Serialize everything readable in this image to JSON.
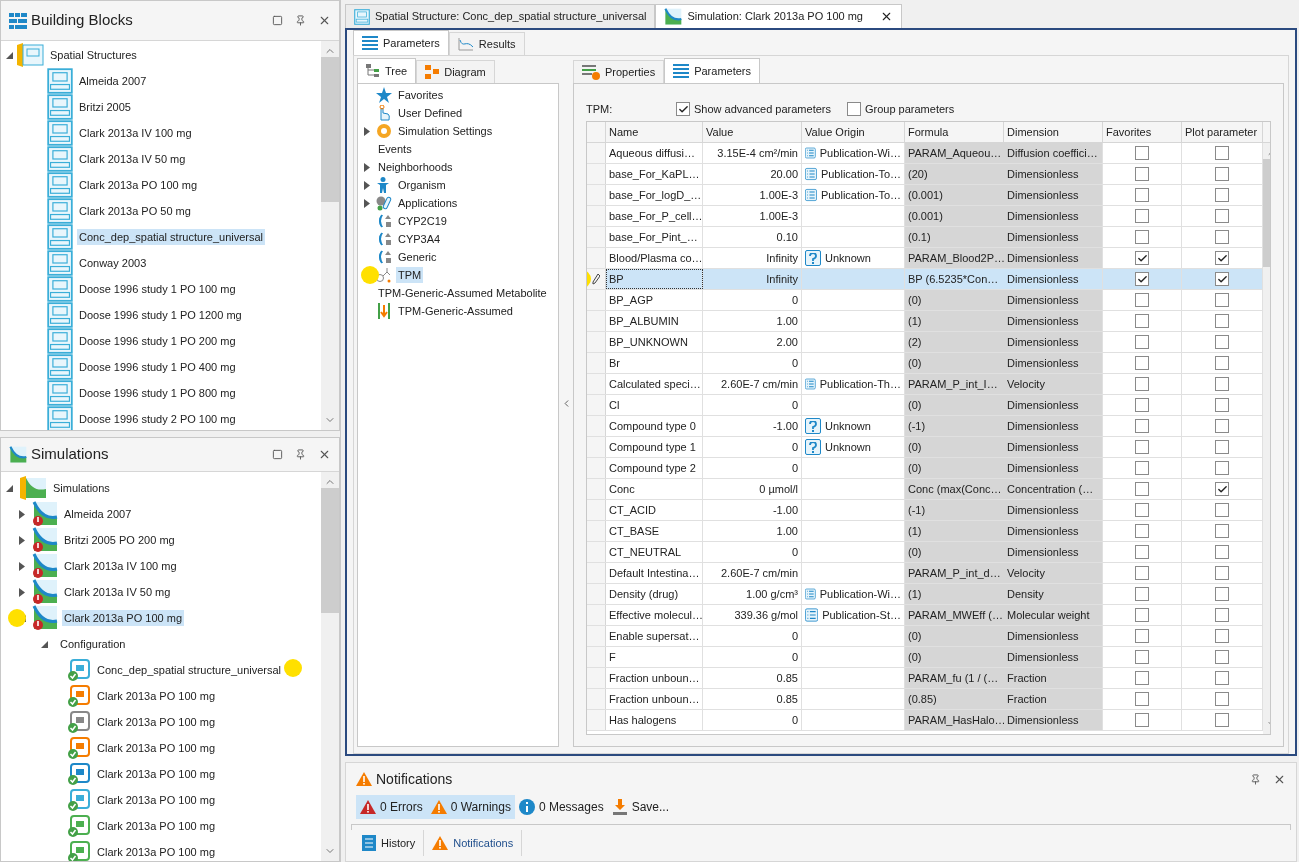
{
  "building_blocks": {
    "title": "Building Blocks",
    "tree": [
      {
        "label": "Spatial Structures",
        "expanded": true,
        "selected": false,
        "children": [
          {
            "label": "Almeida 2007",
            "selected": false
          },
          {
            "label": "Britzi 2005",
            "selected": false
          },
          {
            "label": "Clark 2013a IV 100 mg",
            "selected": false
          },
          {
            "label": "Clark 2013a IV 50 mg",
            "selected": false
          },
          {
            "label": "Clark 2013a PO 100 mg",
            "selected": false
          },
          {
            "label": "Clark 2013a PO 50 mg",
            "selected": false
          },
          {
            "label": "Conc_dep_spatial structure_universal",
            "selected": true
          },
          {
            "label": "Conway 2003",
            "selected": false
          },
          {
            "label": "Doose 1996 study 1 PO 100 mg",
            "selected": false
          },
          {
            "label": "Doose 1996 study 1 PO 1200 mg",
            "selected": false
          },
          {
            "label": "Doose 1996 study 1 PO 200 mg",
            "selected": false
          },
          {
            "label": "Doose 1996 study 1 PO 400 mg",
            "selected": false
          },
          {
            "label": "Doose 1996 study 1 PO 800 mg",
            "selected": false
          },
          {
            "label": "Doose 1996 study 2 PO 100 mg",
            "selected": false
          }
        ]
      }
    ]
  },
  "simulations": {
    "title": "Simulations",
    "tree": [
      {
        "label": "Simulations",
        "expanded": true,
        "selected": false,
        "kind": "folder",
        "children": [
          {
            "label": "Almeida 2007",
            "expanded": false,
            "selected": false,
            "kind": "simulation"
          },
          {
            "label": "Britzi 2005 PO 200 mg",
            "expanded": false,
            "selected": false,
            "kind": "simulation"
          },
          {
            "label": "Clark 2013a IV 100 mg",
            "expanded": false,
            "selected": false,
            "kind": "simulation"
          },
          {
            "label": "Clark 2013a IV 50 mg",
            "expanded": false,
            "selected": false,
            "kind": "simulation"
          },
          {
            "label": "Clark 2013a PO 100 mg",
            "expanded": true,
            "selected": true,
            "marked": true,
            "kind": "simulation",
            "children": [
              {
                "label": "Configuration",
                "expanded": true,
                "selected": false,
                "children": [
                  {
                    "label": "Conc_dep_spatial structure_universal",
                    "selected": false,
                    "marked": true,
                    "kind": "block"
                  },
                  {
                    "label": "Clark 2013a PO 100 mg",
                    "selected": false,
                    "kind": "block"
                  },
                  {
                    "label": "Clark 2013a PO 100 mg",
                    "selected": false,
                    "kind": "block"
                  },
                  {
                    "label": "Clark 2013a PO 100 mg",
                    "selected": false,
                    "kind": "block"
                  },
                  {
                    "label": "Clark 2013a PO 100 mg",
                    "selected": false,
                    "kind": "block"
                  },
                  {
                    "label": "Clark 2013a PO 100 mg",
                    "selected": false,
                    "kind": "block"
                  },
                  {
                    "label": "Clark 2013a PO 100 mg",
                    "selected": false,
                    "kind": "block"
                  },
                  {
                    "label": "Clark 2013a PO 100 mg",
                    "selected": false,
                    "kind": "block"
                  }
                ]
              }
            ]
          }
        ]
      }
    ]
  },
  "document_tabs": [
    {
      "label": "Spatial Structure: Conc_dep_spatial structure_universal",
      "selected": false,
      "kind": "spatial"
    },
    {
      "label": "Simulation: Clark 2013a PO 100 mg",
      "selected": true,
      "kind": "simulation"
    }
  ],
  "view_tabs": [
    {
      "label": "Parameters",
      "selected": true,
      "kind": "list"
    },
    {
      "label": "Results",
      "selected": false,
      "kind": "chart"
    }
  ],
  "nav_tabs": [
    {
      "label": "Tree",
      "selected": true,
      "kind": "tree"
    },
    {
      "label": "Diagram",
      "selected": false,
      "kind": "diagram"
    }
  ],
  "nav_tree": [
    {
      "label": "Favorites",
      "selected": false,
      "kind": "star"
    },
    {
      "label": "User Defined",
      "selected": false,
      "kind": "hand"
    },
    {
      "label": "Simulation Settings",
      "selected": false,
      "expanded": false,
      "kind": "gear"
    },
    {
      "label": "Events",
      "selected": false,
      "kind": "none"
    },
    {
      "label": "Neighborhoods",
      "selected": false,
      "expanded": false,
      "kind": "none"
    },
    {
      "label": "Organism",
      "selected": false,
      "expanded": false,
      "kind": "person"
    },
    {
      "label": "Applications",
      "selected": false,
      "expanded": false,
      "kind": "pill"
    },
    {
      "label": "CYP2C19",
      "selected": false,
      "kind": "enzyme"
    },
    {
      "label": "CYP3A4",
      "selected": false,
      "kind": "enzyme"
    },
    {
      "label": "Generic",
      "selected": false,
      "kind": "enzyme"
    },
    {
      "label": "TPM",
      "selected": true,
      "marked": true,
      "kind": "molecule"
    },
    {
      "label": "TPM-Generic-Assumed Metabolite",
      "selected": false,
      "kind": "none"
    },
    {
      "label": "TPM-Generic-Assumed",
      "selected": false,
      "kind": "transport"
    }
  ],
  "detail_tabs": [
    {
      "label": "Properties",
      "selected": false,
      "kind": "properties"
    },
    {
      "label": "Parameters",
      "selected": true,
      "kind": "list"
    }
  ],
  "parameters": {
    "label": "TPM:",
    "options": [
      {
        "label": "Show advanced parameters",
        "checked": true
      },
      {
        "label": "Group parameters",
        "checked": false
      }
    ],
    "columns": [
      "Name",
      "Value",
      "Value Origin",
      "Formula",
      "Dimension",
      "Favorites",
      "Plot parameter"
    ],
    "rows": [
      {
        "name": "Aqueous diffusi…",
        "value": "3.15E-4 cm²/min",
        "origin": {
          "label": "Publication-Wi…",
          "kind": "publication"
        },
        "formula": "PARAM_Aqueou…",
        "dimension": "Diffusion coeffici…",
        "favorite": false,
        "plot": false,
        "selected": false
      },
      {
        "name": "base_For_KaPL…",
        "value": "20.00",
        "origin": {
          "label": "Publication-To…",
          "kind": "publication"
        },
        "formula": "(20)",
        "dimension": "Dimensionless",
        "favorite": false,
        "plot": false,
        "selected": false
      },
      {
        "name": "base_For_logD_…",
        "value": "1.00E-3",
        "origin": {
          "label": "Publication-To…",
          "kind": "publication"
        },
        "formula": "(0.001)",
        "dimension": "Dimensionless",
        "favorite": false,
        "plot": false,
        "selected": false
      },
      {
        "name": "base_For_P_cell…",
        "value": "1.00E-3",
        "formula": "(0.001)",
        "dimension": "Dimensionless",
        "favorite": false,
        "plot": false,
        "selected": false
      },
      {
        "name": "base_For_Pint_…",
        "value": "0.10",
        "formula": "(0.1)",
        "dimension": "Dimensionless",
        "favorite": false,
        "plot": false,
        "selected": false
      },
      {
        "name": "Blood/Plasma co…",
        "value": "Infinity",
        "origin": {
          "label": "Unknown",
          "kind": "unknown"
        },
        "formula": "PARAM_Blood2P…",
        "dimension": "Dimensionless",
        "favorite": true,
        "plot": true,
        "selected": false
      },
      {
        "name": "BP",
        "value": "Infinity",
        "formula": "BP (6.5235*Con…",
        "dimension": "Dimensionless",
        "favorite": true,
        "plot": true,
        "selected": true,
        "editing": true
      },
      {
        "name": "BP_AGP",
        "value": "0",
        "formula": "(0)",
        "dimension": "Dimensionless",
        "favorite": false,
        "plot": false,
        "selected": false
      },
      {
        "name": "BP_ALBUMIN",
        "value": "1.00",
        "formula": "(1)",
        "dimension": "Dimensionless",
        "favorite": false,
        "plot": false,
        "selected": false
      },
      {
        "name": "BP_UNKNOWN",
        "value": "2.00",
        "formula": "(2)",
        "dimension": "Dimensionless",
        "favorite": false,
        "plot": false,
        "selected": false
      },
      {
        "name": "Br",
        "value": "0",
        "formula": "(0)",
        "dimension": "Dimensionless",
        "favorite": false,
        "plot": false,
        "selected": false
      },
      {
        "name": "Calculated speci…",
        "value": "2.60E-7 cm/min",
        "origin": {
          "label": "Publication-Th…",
          "kind": "publication"
        },
        "formula": "PARAM_P_int_I…",
        "dimension": "Velocity",
        "favorite": false,
        "plot": false,
        "selected": false
      },
      {
        "name": "Cl",
        "value": "0",
        "formula": "(0)",
        "dimension": "Dimensionless",
        "favorite": false,
        "plot": false,
        "selected": false
      },
      {
        "name": "Compound type 0",
        "value": "-1.00",
        "origin": {
          "label": "Unknown",
          "kind": "unknown"
        },
        "formula": "(-1)",
        "dimension": "Dimensionless",
        "favorite": false,
        "plot": false,
        "selected": false
      },
      {
        "name": "Compound type 1",
        "value": "0",
        "origin": {
          "label": "Unknown",
          "kind": "unknown"
        },
        "formula": "(0)",
        "dimension": "Dimensionless",
        "favorite": false,
        "plot": false,
        "selected": false
      },
      {
        "name": "Compound type 2",
        "value": "0",
        "formula": "(0)",
        "dimension": "Dimensionless",
        "favorite": false,
        "plot": false,
        "selected": false
      },
      {
        "name": "Conc",
        "value": "0 µmol/l",
        "formula": "Conc (max(Conc…",
        "dimension": "Concentration (…",
        "favorite": false,
        "plot": true,
        "selected": false
      },
      {
        "name": "CT_ACID",
        "value": "-1.00",
        "formula": "(-1)",
        "dimension": "Dimensionless",
        "favorite": false,
        "plot": false,
        "selected": false
      },
      {
        "name": "CT_BASE",
        "value": "1.00",
        "formula": "(1)",
        "dimension": "Dimensionless",
        "favorite": false,
        "plot": false,
        "selected": false
      },
      {
        "name": "CT_NEUTRAL",
        "value": "0",
        "formula": "(0)",
        "dimension": "Dimensionless",
        "favorite": false,
        "plot": false,
        "selected": false
      },
      {
        "name": "Default Intestina…",
        "value": "2.60E-7 cm/min",
        "formula": "PARAM_P_int_d…",
        "dimension": "Velocity",
        "favorite": false,
        "plot": false,
        "selected": false
      },
      {
        "name": "Density (drug)",
        "value": "1.00 g/cm³",
        "origin": {
          "label": "Publication-Wi…",
          "kind": "publication"
        },
        "formula": "(1)",
        "dimension": "Density",
        "favorite": false,
        "plot": false,
        "selected": false
      },
      {
        "name": "Effective molecul…",
        "value": "339.36 g/mol",
        "origin": {
          "label": "Publication-St…",
          "kind": "publication"
        },
        "formula": "PARAM_MWEff (…",
        "dimension": "Molecular weight",
        "favorite": false,
        "plot": false,
        "selected": false
      },
      {
        "name": "Enable supersat…",
        "value": "0",
        "formula": "(0)",
        "dimension": "Dimensionless",
        "favorite": false,
        "plot": false,
        "selected": false
      },
      {
        "name": "F",
        "value": "0",
        "formula": "(0)",
        "dimension": "Dimensionless",
        "favorite": false,
        "plot": false,
        "selected": false
      },
      {
        "name": "Fraction unboun…",
        "value": "0.85",
        "formula": "PARAM_fu (1 / (…",
        "dimension": "Fraction",
        "favorite": false,
        "plot": false,
        "selected": false
      },
      {
        "name": "Fraction unboun…",
        "value": "0.85",
        "formula": "(0.85)",
        "dimension": "Fraction",
        "favorite": false,
        "plot": false,
        "selected": false
      },
      {
        "name": "Has halogens",
        "value": "0",
        "formula": "PARAM_HasHalo…",
        "dimension": "Dimensionless",
        "favorite": false,
        "plot": false,
        "selected": false
      }
    ]
  },
  "notifications": {
    "title": "Notifications",
    "filters": [
      {
        "label": "0 Errors",
        "kind": "error",
        "selected": true
      },
      {
        "label": "0 Warnings",
        "kind": "warning",
        "selected": true
      },
      {
        "label": "0 Messages",
        "kind": "info",
        "selected": false
      }
    ],
    "save": "Save..."
  },
  "bottom_tabs": [
    {
      "label": "History",
      "selected": false,
      "kind": "history"
    },
    {
      "label": "Notifications",
      "selected": true,
      "kind": "warning"
    }
  ]
}
